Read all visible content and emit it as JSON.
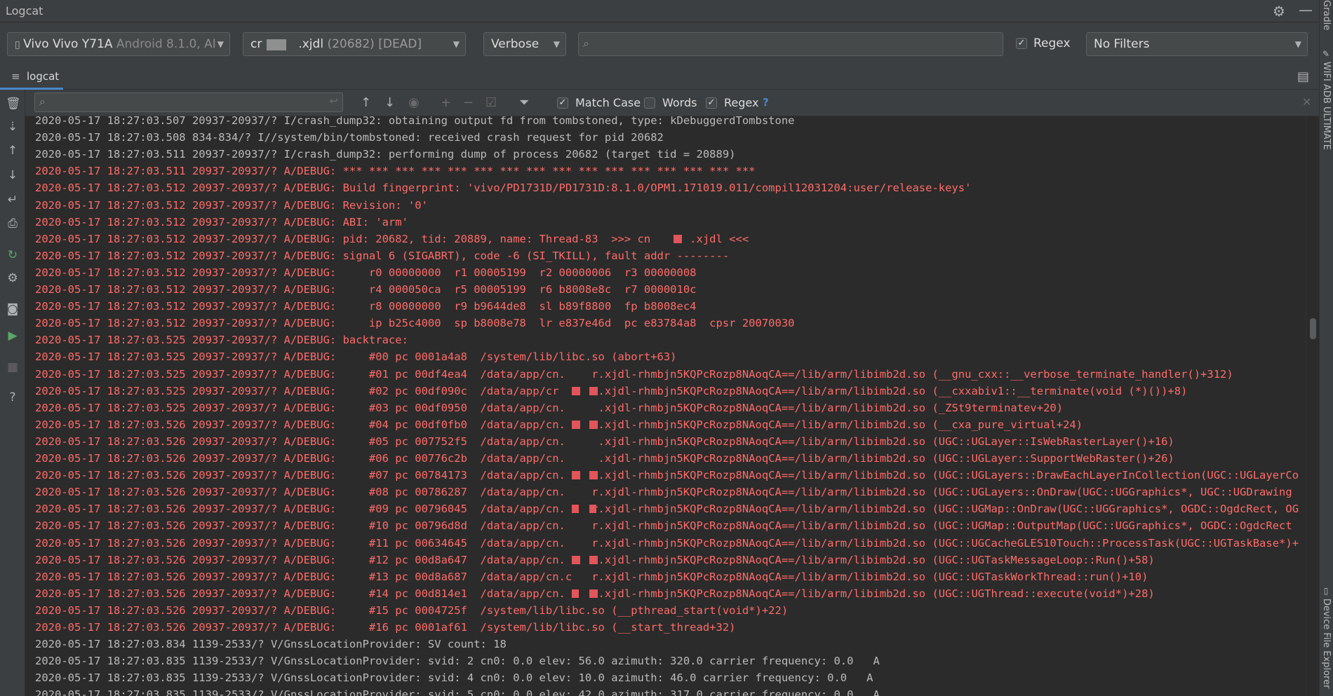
{
  "window": {
    "title": "Logcat"
  },
  "right_strip": {
    "top_label": "Gradle",
    "mid_label": "WIFI ADB ULTIMATE",
    "bottom_label": "Device File Explorer"
  },
  "device_combo": {
    "name": "Vivo Vivo Y71A",
    "detail": "Android 8.1.0, AI"
  },
  "process_combo": {
    "prefix": "cr",
    "name": ".xjdl",
    "pid": "(20682)",
    "status": "[DEAD]"
  },
  "level_combo": {
    "value": "Verbose"
  },
  "filter_search": {
    "placeholder": ""
  },
  "regex_top": {
    "label": "Regex",
    "checked": true
  },
  "filters_combo": {
    "value": "No Filters"
  },
  "tabs": [
    {
      "label": "logcat",
      "active": true
    }
  ],
  "search_toolbar": {
    "placeholder": "",
    "match_case": {
      "label": "Match Case",
      "checked": true
    },
    "words": {
      "label": "Words",
      "checked": false
    },
    "regex": {
      "label": "Regex",
      "checked": true
    },
    "help": "?"
  },
  "log_lines": [
    {
      "level": "I",
      "text": "2020-05-17 18:27:03.507 20937-20937/? I/crash_dump32: obtaining output fd from tombstoned, type: kDebuggerdTombstone"
    },
    {
      "level": "I",
      "text": "2020-05-17 18:27:03.508 834-834/? I//system/bin/tombstoned: received crash request for pid 20682"
    },
    {
      "level": "I",
      "text": "2020-05-17 18:27:03.511 20937-20937/? I/crash_dump32: performing dump of process 20682 (target tid = 20889)"
    },
    {
      "level": "A",
      "text": "2020-05-17 18:27:03.511 20937-20937/? A/DEBUG: *** *** *** *** *** *** *** *** *** *** *** *** *** *** *** ***"
    },
    {
      "level": "A",
      "text": "2020-05-17 18:27:03.512 20937-20937/? A/DEBUG: Build fingerprint: 'vivo/PD1731D/PD1731D:8.1.0/OPM1.171019.011/compil12031204:user/release-keys'"
    },
    {
      "level": "A",
      "text": "2020-05-17 18:27:03.512 20937-20937/? A/DEBUG: Revision: '0'"
    },
    {
      "level": "A",
      "text": "2020-05-17 18:27:03.512 20937-20937/? A/DEBUG: ABI: 'arm'"
    },
    {
      "level": "A",
      "text": "2020-05-17 18:27:03.512 20937-20937/? A/DEBUG: pid: 20682, tid: 20889, name: Thread-83  >>> cn      .xjdl <<<"
    },
    {
      "level": "A",
      "text": "2020-05-17 18:27:03.512 20937-20937/? A/DEBUG: signal 6 (SIGABRT), code -6 (SI_TKILL), fault addr --------"
    },
    {
      "level": "A",
      "text": "2020-05-17 18:27:03.512 20937-20937/? A/DEBUG:     r0 00000000  r1 00005199  r2 00000006  r3 00000008"
    },
    {
      "level": "A",
      "text": "2020-05-17 18:27:03.512 20937-20937/? A/DEBUG:     r4 000050ca  r5 00005199  r6 b8008e8c  r7 0000010c"
    },
    {
      "level": "A",
      "text": "2020-05-17 18:27:03.512 20937-20937/? A/DEBUG:     r8 00000000  r9 b9644de8  sl b89f8800  fp b8008ec4"
    },
    {
      "level": "A",
      "text": "2020-05-17 18:27:03.512 20937-20937/? A/DEBUG:     ip b25c4000  sp b8008e78  lr e837e46d  pc e83784a8  cpsr 20070030"
    },
    {
      "level": "A",
      "text": "2020-05-17 18:27:03.525 20937-20937/? A/DEBUG: backtrace:"
    },
    {
      "level": "A",
      "text": "2020-05-17 18:27:03.525 20937-20937/? A/DEBUG:     #00 pc 0001a4a8  /system/lib/libc.so (abort+63)"
    },
    {
      "level": "A",
      "text": "2020-05-17 18:27:03.525 20937-20937/? A/DEBUG:     #01 pc 00df4ea4  /data/app/cn.    r.xjdl-rhmbjn5KQPcRozp8NAoqCA==/lib/arm/libimb2d.so (__gnu_cxx::__verbose_terminate_handler()+312)"
    },
    {
      "level": "A",
      "text": "2020-05-17 18:27:03.525 20937-20937/? A/DEBUG:     #02 pc 00df090c  /data/app/cr      .xjdl-rhmbjn5KQPcRozp8NAoqCA==/lib/arm/libimb2d.so (__cxxabiv1::__terminate(void (*)())+8)"
    },
    {
      "level": "A",
      "text": "2020-05-17 18:27:03.525 20937-20937/? A/DEBUG:     #03 pc 00df0950  /data/app/cn.     .xjdl-rhmbjn5KQPcRozp8NAoqCA==/lib/arm/libimb2d.so (_ZSt9terminatev+20)"
    },
    {
      "level": "A",
      "text": "2020-05-17 18:27:03.526 20937-20937/? A/DEBUG:     #04 pc 00df0fb0  /data/app/cn.     .xjdl-rhmbjn5KQPcRozp8NAoqCA==/lib/arm/libimb2d.so (__cxa_pure_virtual+24)"
    },
    {
      "level": "A",
      "text": "2020-05-17 18:27:03.526 20937-20937/? A/DEBUG:     #05 pc 007752f5  /data/app/cn.     .xjdl-rhmbjn5KQPcRozp8NAoqCA==/lib/arm/libimb2d.so (UGC::UGLayer::IsWebRasterLayer()+16)"
    },
    {
      "level": "A",
      "text": "2020-05-17 18:27:03.526 20937-20937/? A/DEBUG:     #06 pc 00776c2b  /data/app/cn.     .xjdl-rhmbjn5KQPcRozp8NAoqCA==/lib/arm/libimb2d.so (UGC::UGLayer::SupportWebRaster()+26)"
    },
    {
      "level": "A",
      "text": "2020-05-17 18:27:03.526 20937-20937/? A/DEBUG:     #07 pc 00784173  /data/app/cn.     .xjdl-rhmbjn5KQPcRozp8NAoqCA==/lib/arm/libimb2d.so (UGC::UGLayers::DrawEachLayerInCollection(UGC::UGLayerCo"
    },
    {
      "level": "A",
      "text": "2020-05-17 18:27:03.526 20937-20937/? A/DEBUG:     #08 pc 00786287  /data/app/cn.    r.xjdl-rhmbjn5KQPcRozp8NAoqCA==/lib/arm/libimb2d.so (UGC::UGLayers::OnDraw(UGC::UGGraphics*, UGC::UGDrawing"
    },
    {
      "level": "A",
      "text": "2020-05-17 18:27:03.526 20937-20937/? A/DEBUG:     #09 pc 00796045  /data/app/cn.    r.xjdl-rhmbjn5KQPcRozp8NAoqCA==/lib/arm/libimb2d.so (UGC::UGMap::OnDraw(UGC::UGGraphics*, OGDC::OgdcRect, OG"
    },
    {
      "level": "A",
      "text": "2020-05-17 18:27:03.526 20937-20937/? A/DEBUG:     #10 pc 00796d8d  /data/app/cn.    r.xjdl-rhmbjn5KQPcRozp8NAoqCA==/lib/arm/libimb2d.so (UGC::UGMap::OutputMap(UGC::UGGraphics*, OGDC::OgdcRect"
    },
    {
      "level": "A",
      "text": "2020-05-17 18:27:03.526 20937-20937/? A/DEBUG:     #11 pc 00634645  /data/app/cn.    r.xjdl-rhmbjn5KQPcRozp8NAoqCA==/lib/arm/libimb2d.so (UGC::UGCacheGLES10Touch::ProcessTask(UGC::UGTaskBase*)+"
    },
    {
      "level": "A",
      "text": "2020-05-17 18:27:03.526 20937-20937/? A/DEBUG:     #12 pc 00d8a647  /data/app/cn.    r.xjdl-rhmbjn5KQPcRozp8NAoqCA==/lib/arm/libimb2d.so (UGC::UGTaskMessageLoop::Run()+58)"
    },
    {
      "level": "A",
      "text": "2020-05-17 18:27:03.526 20937-20937/? A/DEBUG:     #13 pc 00d8a687  /data/app/cn.c   r.xjdl-rhmbjn5KQPcRozp8NAoqCA==/lib/arm/libimb2d.so (UGC::UGTaskWorkThread::run()+10)"
    },
    {
      "level": "A",
      "text": "2020-05-17 18:27:03.526 20937-20937/? A/DEBUG:     #14 pc 00d814e1  /data/app/cn.    r.xjdl-rhmbjn5KQPcRozp8NAoqCA==/lib/arm/libimb2d.so (UGC::UGThread::execute(void*)+28)"
    },
    {
      "level": "A",
      "text": "2020-05-17 18:27:03.526 20937-20937/? A/DEBUG:     #15 pc 0004725f  /system/lib/libc.so (__pthread_start(void*)+22)"
    },
    {
      "level": "A",
      "text": "2020-05-17 18:27:03.526 20937-20937/? A/DEBUG:     #16 pc 0001af61  /system/lib/libc.so (__start_thread+32)"
    },
    {
      "level": "V",
      "text": "2020-05-17 18:27:03.834 1139-2533/? V/GnssLocationProvider: SV count: 18"
    },
    {
      "level": "V",
      "text": "2020-05-17 18:27:03.835 1139-2533/? V/GnssLocationProvider: svid: 2 cn0: 0.0 elev: 56.0 azimuth: 320.0 carrier frequency: 0.0   A"
    },
    {
      "level": "V",
      "text": "2020-05-17 18:27:03.835 1139-2533/? V/GnssLocationProvider: svid: 4 cn0: 0.0 elev: 10.0 azimuth: 46.0 carrier frequency: 0.0   A"
    },
    {
      "level": "V",
      "text": "2020-05-17 18:27:03.835 1139-2533/? V/GnssLocationProvider: svid: 5 cn0: 0.0 elev: 42.0 azimuth: 317.0 carrier frequency: 0.0   A"
    }
  ],
  "colors": {
    "fatal": "#ff6b68",
    "info": "#bbbbbb",
    "accent": "#4a88c7",
    "background": "#2b2b2b",
    "panel": "#3c3f41"
  }
}
